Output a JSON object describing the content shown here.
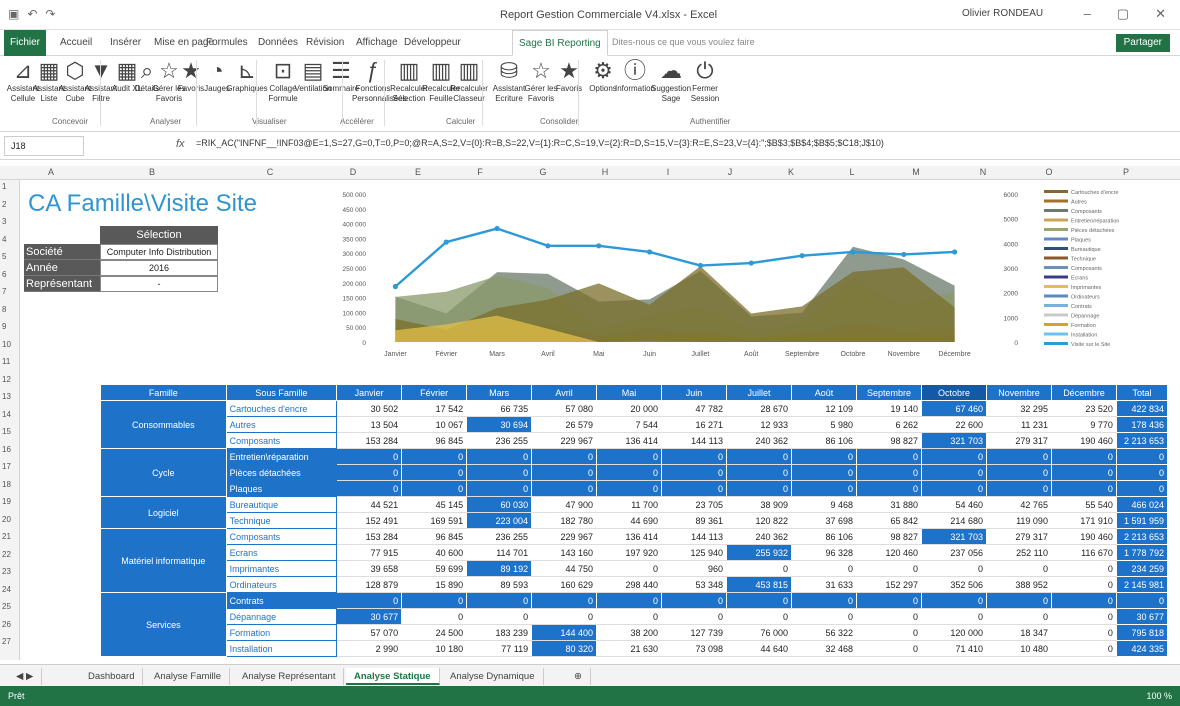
{
  "window": {
    "title": "Report Gestion Commerciale V4.xlsx - Excel",
    "user": "Olivier RONDEAU"
  },
  "tabs": [
    "Fichier",
    "Accueil",
    "Insérer",
    "Mise en page",
    "Formules",
    "Données",
    "Révision",
    "Affichage",
    "Développeur",
    "Sage BI Reporting"
  ],
  "tell_me": "Dites-nous ce que vous voulez faire",
  "share": "Partager",
  "ribbon": {
    "buttons": [
      {
        "label": "Assistant Cellule",
        "icon": "assistant-cell-icon"
      },
      {
        "label": "Assistant Liste",
        "icon": "assistant-list-icon"
      },
      {
        "label": "Assistant Cube",
        "icon": "assistant-cube-icon"
      },
      {
        "label": "Assistant Filtre",
        "icon": "assistant-filter-icon"
      },
      {
        "label": "Audit XL",
        "icon": "audit-icon"
      },
      {
        "label": "Détails",
        "icon": "details-icon"
      },
      {
        "label": "Gérer les Favoris",
        "icon": "manage-favorites-icon"
      },
      {
        "label": "Favoris",
        "icon": "favorites-icon"
      },
      {
        "label": "Jauges",
        "icon": "gauges-icon"
      },
      {
        "label": "Graphiques",
        "icon": "charts-icon"
      },
      {
        "label": "Collage Formule",
        "icon": "paste-formula-icon"
      },
      {
        "label": "Ventilation",
        "icon": "ventilation-icon"
      },
      {
        "label": "Sommaire",
        "icon": "summary-icon"
      },
      {
        "label": "Fonctions Personnalisées",
        "icon": "functions-icon"
      },
      {
        "label": "Recalculer Sélection",
        "icon": "recalc-selection-icon"
      },
      {
        "label": "Recalculer Feuille",
        "icon": "recalc-sheet-icon"
      },
      {
        "label": "Recalculer Classeur",
        "icon": "recalc-workbook-icon"
      },
      {
        "label": "Assistant Ecriture",
        "icon": "write-assistant-icon"
      },
      {
        "label": "Gérer les Favoris",
        "icon": "manage-favorites2-icon"
      },
      {
        "label": "Favoris",
        "icon": "favorites2-icon"
      },
      {
        "label": "Options",
        "icon": "options-icon"
      },
      {
        "label": "Information",
        "icon": "information-icon"
      },
      {
        "label": "Suggestion Sage",
        "icon": "suggestion-icon"
      },
      {
        "label": "Fermer Session",
        "icon": "close-session-icon"
      }
    ],
    "groups": [
      "Concevoir",
      "Analyser",
      "Visualiser",
      "Accélérer",
      "Calculer",
      "Consolider",
      "Authentifier"
    ]
  },
  "formula_bar": {
    "cell": "J18",
    "formula": "=RIK_AC(\"INFNF__!INF03@E=1,S=27,G=0,T=0,P=0;@R=A,S=2,V={0}:R=B,S=22,V={1}:R=C,S=19,V={2}:R=D,S=15,V={3}:R=E,S=23,V={4}:\";$B$3;$B$4;$B$5;$C18;J$10)"
  },
  "columns": [
    "A",
    "B",
    "C",
    "D",
    "E",
    "F",
    "G",
    "H",
    "I",
    "J",
    "K",
    "L",
    "M",
    "N",
    "O",
    "P"
  ],
  "rows": [
    "1",
    "2",
    "3",
    "4",
    "5",
    "6",
    "7",
    "8",
    "9",
    "10",
    "11",
    "12",
    "13",
    "14",
    "15",
    "16",
    "17",
    "18",
    "19",
    "20",
    "21",
    "22",
    "23",
    "24",
    "25",
    "26",
    "27"
  ],
  "sheet_title": "CA Famille\\Visite Site",
  "selection": {
    "header": "Sélection",
    "items": [
      {
        "label": "Société",
        "value": "Computer Info Distribution"
      },
      {
        "label": "Année",
        "value": "2016"
      },
      {
        "label": "Représentant",
        "value": "-"
      }
    ]
  },
  "chart_data": {
    "type": "area",
    "categories": [
      "Janvier",
      "Février",
      "Mars",
      "Avril",
      "Mai",
      "Juin",
      "Juillet",
      "Août",
      "Septembre",
      "Octobre",
      "Novembre",
      "Décembre"
    ],
    "y_left": {
      "ticks": [
        "0",
        "50 000",
        "100 000",
        "150 000",
        "200 000",
        "250 000",
        "300 000",
        "350 000",
        "400 000",
        "450 000",
        "500 000"
      ],
      "range": [
        0,
        500000
      ]
    },
    "y_right": {
      "ticks": [
        "0",
        "1000",
        "2000",
        "3000",
        "4000",
        "5000",
        "6000"
      ],
      "range": [
        0,
        6000
      ]
    },
    "series": [
      {
        "name": "Cartouches d'encre",
        "color": "#8e7b3a",
        "values": [
          30502,
          17542,
          66735,
          57080,
          20000,
          47782,
          28670,
          12109,
          19140,
          67460,
          32295,
          23520
        ]
      },
      {
        "name": "Autres",
        "color": "#a96d2a",
        "values": [
          13504,
          10067,
          30694,
          26579,
          7544,
          16271,
          12933,
          5980,
          6262,
          22600,
          11231,
          9770
        ]
      },
      {
        "name": "Composants",
        "color": "#6b7a6b",
        "values": [
          153284,
          96845,
          236255,
          229967,
          136414,
          144113,
          240362,
          86106,
          98827,
          321703,
          279317,
          190460
        ]
      },
      {
        "name": "Bureautique",
        "color": "#c08a2a",
        "values": [
          44521,
          45145,
          60030,
          47900,
          11700,
          23705,
          38909,
          9468,
          31880,
          54460,
          42765,
          55540
        ]
      },
      {
        "name": "Technique",
        "color": "#8a9a6a",
        "values": [
          152491,
          169591,
          223004,
          182780,
          44690,
          89361,
          120822,
          37698,
          65842,
          214680,
          119090,
          171910
        ]
      },
      {
        "name": "Ecrans",
        "color": "#7a6e2a",
        "values": [
          77915,
          40600,
          114701,
          143160,
          197920,
          125940,
          255932,
          96328,
          120460,
          237056,
          252110,
          116670
        ]
      },
      {
        "name": "Imprimantes",
        "color": "#e3c04a",
        "values": [
          39658,
          59699,
          89192,
          44750,
          0,
          960,
          0,
          0,
          0,
          0,
          0,
          0
        ]
      },
      {
        "name": "Visite sur le Site",
        "color": "#2b9ad7",
        "line": true,
        "values": [
          2250,
          4050,
          4600,
          3900,
          3900,
          3650,
          3100,
          3200,
          3500,
          3650,
          3550,
          3650
        ]
      }
    ],
    "legend": [
      "Cartouches d'encre",
      "Autres",
      "Composants",
      "Entretien/réparation",
      "Pièces détachées",
      "Plaques",
      "Bureautique",
      "Technique",
      "Composants",
      "Ecrans",
      "Imprimantes",
      "Ordinateurs",
      "Contrats",
      "Dépannage",
      "Formation",
      "Installation",
      "Visite sur le Site"
    ],
    "legend_colors": [
      "#7f6a2f",
      "#a96d2a",
      "#6b7a6b",
      "#c9a45a",
      "#9aa56a",
      "#5f8ac7",
      "#2f4f7a",
      "#8a5a2a",
      "#6e8fb7",
      "#3a3a8a",
      "#e3c04a",
      "#5a8abf",
      "#7ab0e0",
      "#c9c9c9",
      "#d9a030",
      "#6ec0f0",
      "#2b9ad7"
    ]
  },
  "table": {
    "headers": [
      "Famille",
      "Sous Famille",
      "Janvier",
      "Février",
      "Mars",
      "Avril",
      "Mai",
      "Juin",
      "Juillet",
      "Août",
      "Septembre",
      "Octobre",
      "Novembre",
      "Décembre",
      "Total"
    ],
    "rows": [
      {
        "fam": "Consommables",
        "span": 3,
        "sf": "Cartouches d'encre",
        "v": [
          "30 502",
          "17 542",
          "66 735",
          "57 080",
          "20 000",
          "47 782",
          "28 670",
          "12 109",
          "19 140",
          "67 460",
          "32 295",
          "23 520"
        ],
        "t": "422 834",
        "hl": [
          9
        ]
      },
      {
        "sf": "Autres",
        "v": [
          "13 504",
          "10 067",
          "30 694",
          "26 579",
          "7 544",
          "16 271",
          "12 933",
          "5 980",
          "6 262",
          "22 600",
          "11 231",
          "9 770"
        ],
        "t": "178 436",
        "hl": [
          2
        ]
      },
      {
        "sf": "Composants",
        "v": [
          "153 284",
          "96 845",
          "236 255",
          "229 967",
          "136 414",
          "144 113",
          "240 362",
          "86 106",
          "98 827",
          "321 703",
          "279 317",
          "190 460"
        ],
        "t": "2 213 653",
        "hl": [
          9
        ]
      },
      {
        "fam": "Cycle",
        "span": 3,
        "sf": "Entretien\\réparation",
        "v": [
          "0",
          "0",
          "0",
          "0",
          "0",
          "0",
          "0",
          "0",
          "0",
          "0",
          "0",
          "0"
        ],
        "t": "0",
        "blue": true
      },
      {
        "sf": "Pièces détachées",
        "v": [
          "0",
          "0",
          "0",
          "0",
          "0",
          "0",
          "0",
          "0",
          "0",
          "0",
          "0",
          "0"
        ],
        "t": "0",
        "blue": true
      },
      {
        "sf": "Plaques",
        "v": [
          "0",
          "0",
          "0",
          "0",
          "0",
          "0",
          "0",
          "0",
          "0",
          "0",
          "0",
          "0"
        ],
        "t": "0",
        "blue": true
      },
      {
        "fam": "Logiciel",
        "span": 2,
        "sf": "Bureautique",
        "v": [
          "44 521",
          "45 145",
          "60 030",
          "47 900",
          "11 700",
          "23 705",
          "38 909",
          "9 468",
          "31 880",
          "54 460",
          "42 765",
          "55 540"
        ],
        "t": "466 024",
        "hl": [
          2
        ]
      },
      {
        "sf": "Technique",
        "v": [
          "152 491",
          "169 591",
          "223 004",
          "182 780",
          "44 690",
          "89 361",
          "120 822",
          "37 698",
          "65 842",
          "214 680",
          "119 090",
          "171 910"
        ],
        "t": "1 591 959",
        "hl": [
          2
        ]
      },
      {
        "fam": "Matériel informatique",
        "span": 4,
        "sf": "Composants",
        "v": [
          "153 284",
          "96 845",
          "236 255",
          "229 967",
          "136 414",
          "144 113",
          "240 362",
          "86 106",
          "98 827",
          "321 703",
          "279 317",
          "190 460"
        ],
        "t": "2 213 653",
        "hl": [
          9
        ]
      },
      {
        "sf": "Ecrans",
        "v": [
          "77 915",
          "40 600",
          "114 701",
          "143 160",
          "197 920",
          "125 940",
          "255 932",
          "96 328",
          "120 460",
          "237 056",
          "252 110",
          "116 670"
        ],
        "t": "1 778 792",
        "hl": [
          6
        ]
      },
      {
        "sf": "Imprimantes",
        "v": [
          "39 658",
          "59 699",
          "89 192",
          "44 750",
          "0",
          "960",
          "0",
          "0",
          "0",
          "0",
          "0",
          "0"
        ],
        "t": "234 259",
        "hl": [
          2
        ]
      },
      {
        "sf": "Ordinateurs",
        "v": [
          "128 879",
          "15 890",
          "89 593",
          "160 629",
          "298 440",
          "53 348",
          "453 815",
          "31 633",
          "152 297",
          "352 506",
          "388 952",
          "0"
        ],
        "t": "2 145 981",
        "hl": [
          6
        ]
      },
      {
        "fam": "Services",
        "span": 4,
        "sf": "Contrats",
        "v": [
          "0",
          "0",
          "0",
          "0",
          "0",
          "0",
          "0",
          "0",
          "0",
          "0",
          "0",
          "0"
        ],
        "t": "0",
        "blue": true
      },
      {
        "sf": "Dépannage",
        "v": [
          "30 677",
          "0",
          "0",
          "0",
          "0",
          "0",
          "0",
          "0",
          "0",
          "0",
          "0",
          "0"
        ],
        "t": "30 677",
        "hl": [
          0
        ]
      },
      {
        "sf": "Formation",
        "v": [
          "57 070",
          "24 500",
          "183 239",
          "144 400",
          "38 200",
          "127 739",
          "76 000",
          "56 322",
          "0",
          "120 000",
          "18 347",
          "0"
        ],
        "t": "795 818",
        "hl": [
          3
        ]
      },
      {
        "sf": "Installation",
        "v": [
          "2 990",
          "10 180",
          "77 119",
          "80 320",
          "21 630",
          "73 098",
          "44 640",
          "32 468",
          "0",
          "71 410",
          "10 480",
          "0"
        ],
        "t": "424 335",
        "hl": [
          3
        ]
      }
    ]
  },
  "sheet_tabs": [
    "Dashboard",
    "Analyse Famille",
    "Analyse Représentant",
    "Analyse Statique",
    "Analyse Dynamique"
  ],
  "active_sheet": "Analyse Statique",
  "status": {
    "ready": "Prêt",
    "zoom": "100 %"
  },
  "colors": {
    "excel_green": "#217346",
    "table_blue": "#1e73c9",
    "title_blue": "#2e95d3",
    "visits_line": "#2b9ad7"
  }
}
